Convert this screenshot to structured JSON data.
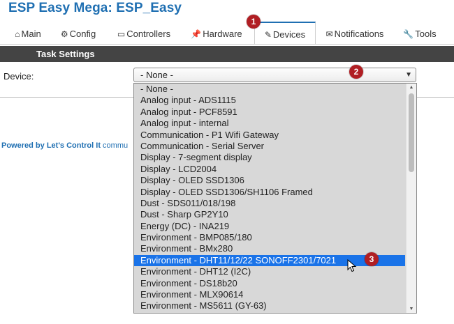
{
  "app": {
    "title": "ESP Easy Mega: ESP_Easy"
  },
  "tabs": [
    {
      "label": "Main",
      "icon": "home-icon"
    },
    {
      "label": "Config",
      "icon": "gear-icon"
    },
    {
      "label": "Controllers",
      "icon": "chat-icon"
    },
    {
      "label": "Hardware",
      "icon": "pin-icon"
    },
    {
      "label": "Devices",
      "icon": "plug-icon",
      "active": true
    },
    {
      "label": "Notifications",
      "icon": "mail-icon"
    },
    {
      "label": "Tools",
      "icon": "wrench-icon"
    }
  ],
  "section": {
    "title": "Task Settings"
  },
  "form": {
    "device_label": "Device:",
    "selected_value": "- None -"
  },
  "footer": {
    "powered_by": "Powered by",
    "brand": "Let's Control It",
    "tail": "commu"
  },
  "dropdown": {
    "options": [
      "- None -",
      "Analog input - ADS1115",
      "Analog input - PCF8591",
      "Analog input - internal",
      "Communication - P1 Wifi Gateway",
      "Communication - Serial Server",
      "Display - 7-segment display",
      "Display - LCD2004",
      "Display - OLED SSD1306",
      "Display - OLED SSD1306/SH1106 Framed",
      "Dust - SDS011/018/198",
      "Dust - Sharp GP2Y10",
      "Energy (DC) - INA219",
      "Environment - BMP085/180",
      "Environment - BMx280",
      "Environment - DHT11/12/22 SONOFF2301/7021",
      "Environment - DHT12 (I2C)",
      "Environment - DS18b20",
      "Environment - MLX90614",
      "Environment - MS5611 (GY-63)"
    ],
    "highlighted_index": 15
  },
  "annotations": {
    "badge1": "1",
    "badge2": "2",
    "badge3": "3"
  },
  "colors": {
    "accent": "#1f6fb2",
    "section_bar": "#444444",
    "highlight": "#1a73e8",
    "badge": "#b01e23"
  }
}
